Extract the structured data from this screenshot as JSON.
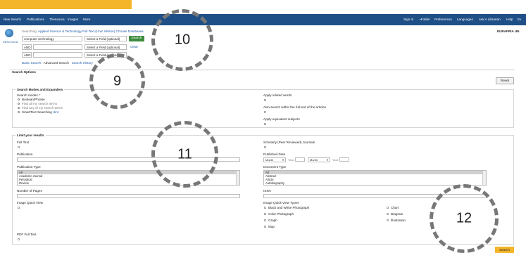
{
  "topnav": {
    "left": [
      "New Search",
      "Publications",
      "Thesaurus",
      "Images",
      "More"
    ],
    "right": [
      "Sign In",
      "Folder",
      "Preferences",
      "Languages",
      "Ask A Librarian",
      "Help",
      "Ex"
    ]
  },
  "logo": {
    "text": "EBSCOhost"
  },
  "searching": {
    "prefix": "Searching:",
    "database": "Applied Science & Technology Full Text (H.W. Wilson)",
    "choose": "Choose Databases"
  },
  "org_name": "EURAFRIA UN",
  "search_rows": [
    {
      "operator": "",
      "value": "computer technology",
      "field": "Select a Field (optional)"
    },
    {
      "operator": "AND",
      "value": "",
      "field": "Select a Field (optional)"
    },
    {
      "operator": "AND",
      "value": "",
      "field": "Select a Field (optional)"
    }
  ],
  "search_button": "Search",
  "clear_link": "Clear",
  "search_links": {
    "basic": "Basic Search",
    "advanced": "Advanced Search",
    "history": "Search History"
  },
  "options": {
    "title": "Search Options",
    "reset": "Reset",
    "modes_section": {
      "legend": "Search Modes and Expanders",
      "modes_label": "Search modes",
      "modes": [
        "Boolean/Phrase",
        "Find all my search terms",
        "Find any of my search terms",
        "SmartText Searching"
      ],
      "hint_link": "Hint",
      "expanders": [
        "Apply related words",
        "Also search within the full text of the articles",
        "Apply equivalent subjects"
      ]
    },
    "limit_section": {
      "legend": "Limit your results",
      "full_text": "Full Text",
      "scholarly": "Scholarly (Peer Reviewed) Journals",
      "publication": "Publication",
      "published_date": "Published Date",
      "date_month1": "Month",
      "date_year1": "Year:",
      "date_month2": "Month",
      "date_year2": "Year:",
      "publication_type": "Publication Type",
      "publication_types": [
        "All",
        "Academic Journal",
        "Periodical",
        "Review"
      ],
      "document_type": "Document Type",
      "document_types": [
        "All",
        "Abstract",
        "Article",
        "Autobiography"
      ],
      "number_of_pages": "Number of Pages",
      "issn": "ISSN",
      "iqv": "Image Quick View",
      "iqv_types_label": "Image Quick View Types",
      "iqv_types": [
        "Black and White Photograph",
        "Chart",
        "Color Photograph",
        "Diagram",
        "Graph",
        "Illustration",
        "Map"
      ],
      "pdf_full_text": "PDF Full Text"
    },
    "search_bottom": "Search"
  },
  "callouts": [
    "10",
    "9",
    "11",
    "12"
  ]
}
